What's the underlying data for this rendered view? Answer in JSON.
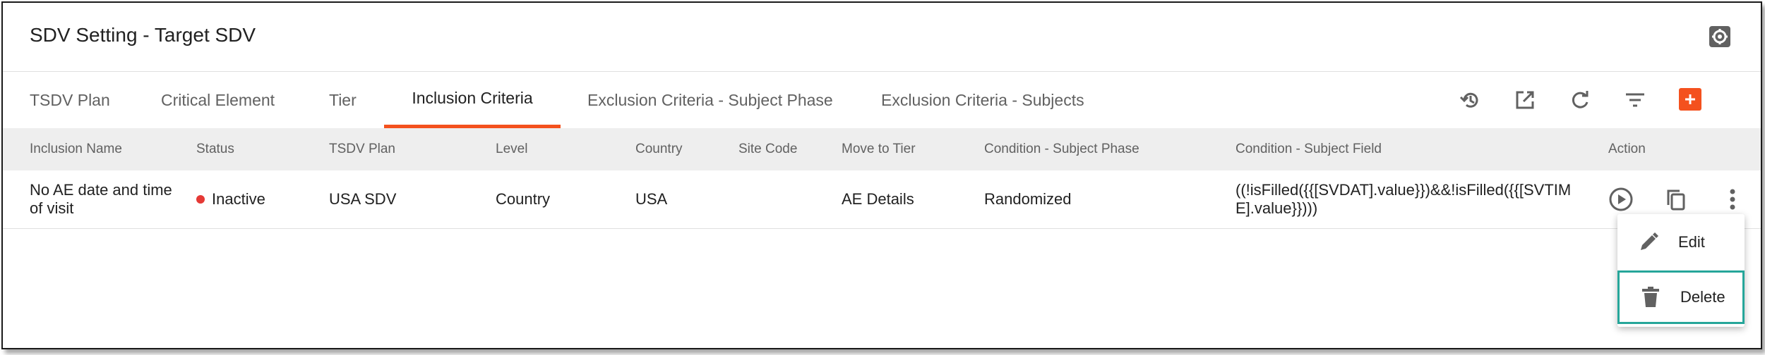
{
  "header": {
    "title": "SDV Setting - Target SDV",
    "settings_icon": "gear-icon"
  },
  "tabs": [
    {
      "label": "TSDV Plan",
      "active": false
    },
    {
      "label": "Critical Element",
      "active": false
    },
    {
      "label": "Tier",
      "active": false
    },
    {
      "label": "Inclusion Criteria",
      "active": true
    },
    {
      "label": "Exclusion Criteria - Subject Phase",
      "active": false
    },
    {
      "label": "Exclusion Criteria - Subjects",
      "active": false
    }
  ],
  "toolbar": {
    "icons": [
      "history-icon",
      "open-external-icon",
      "refresh-icon",
      "filter-icon",
      "add-icon"
    ],
    "accent": "#f4511e"
  },
  "table": {
    "columns": [
      "Inclusion Name",
      "Status",
      "TSDV Plan",
      "Level",
      "Country",
      "Site Code",
      "Move to Tier",
      "Condition - Subject Phase",
      "Condition - Subject Field",
      "Action"
    ],
    "rows": [
      {
        "inclusion_name": "No AE date and time of visit",
        "status": "Inactive",
        "status_color": "#e53935",
        "tsdv_plan": "USA SDV",
        "level": "Country",
        "country": "USA",
        "site_code": "",
        "move_to_tier": "AE Details",
        "condition_phase": "Randomized",
        "condition_field": "((!isFilled({{[SVDAT].value}})&&!isFilled({{[SVTIME].value}})))"
      }
    ]
  },
  "row_actions": [
    "play-icon",
    "copy-icon",
    "more-vert-icon"
  ],
  "context_menu": {
    "items": [
      {
        "label": "Edit",
        "icon": "pencil-icon"
      },
      {
        "label": "Delete",
        "icon": "trash-icon",
        "highlight": true
      }
    ],
    "highlight_color": "#26a69a"
  }
}
